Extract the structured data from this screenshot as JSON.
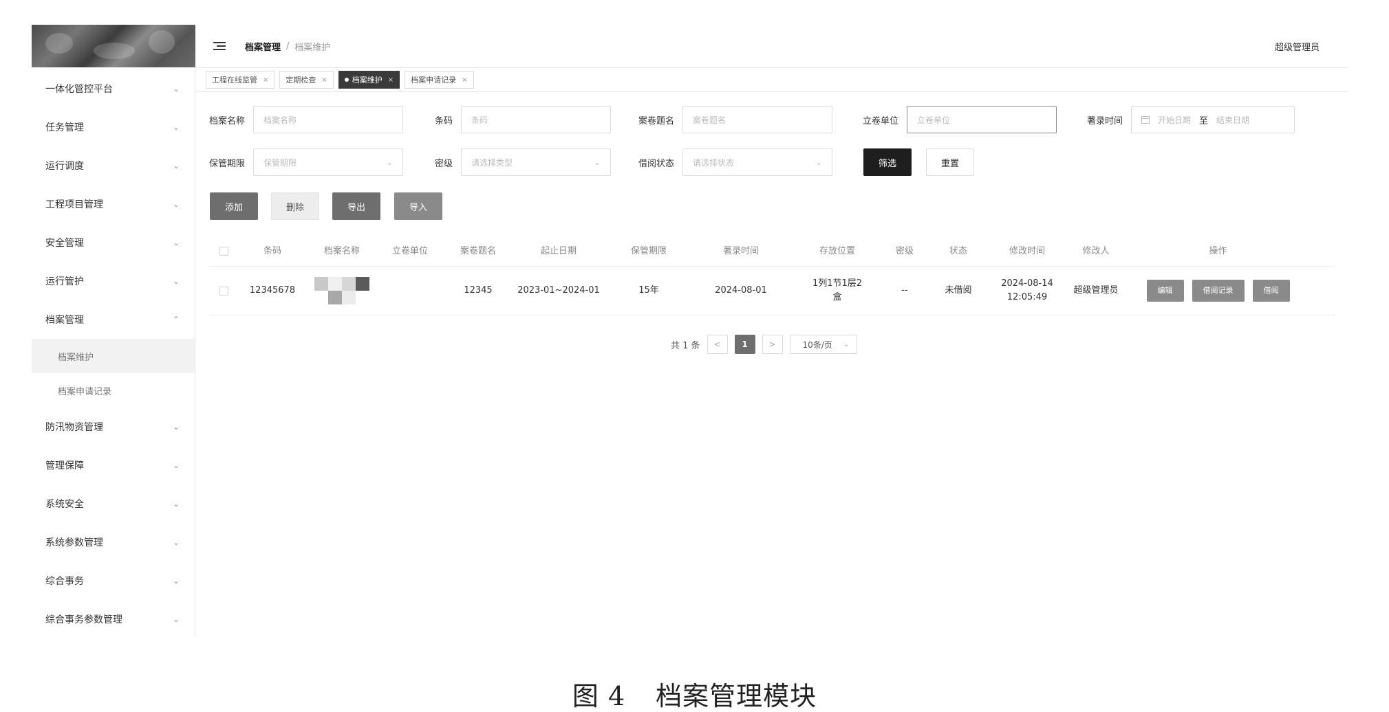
{
  "sidebar": {
    "items": [
      {
        "label": "一体化管控平台",
        "chevron": "v"
      },
      {
        "label": "任务管理",
        "chevron": "v"
      },
      {
        "label": "运行调度",
        "chevron": "v"
      },
      {
        "label": "工程项目管理",
        "chevron": "v"
      },
      {
        "label": "安全管理",
        "chevron": "v"
      },
      {
        "label": "运行管护",
        "chevron": "v"
      },
      {
        "label": "档案管理",
        "chevron": "^"
      },
      {
        "label": "防汛物资管理",
        "chevron": "v"
      },
      {
        "label": "管理保障",
        "chevron": "v"
      },
      {
        "label": "系统安全",
        "chevron": "v"
      },
      {
        "label": "系统参数管理",
        "chevron": "v"
      },
      {
        "label": "综合事务",
        "chevron": "v"
      },
      {
        "label": "综合事务参数管理",
        "chevron": "v"
      }
    ],
    "subitems": [
      {
        "label": "档案维护"
      },
      {
        "label": "档案申请记录"
      }
    ]
  },
  "header": {
    "breadcrumb": [
      "档案管理",
      "/",
      "档案维护"
    ],
    "user": "超级管理员"
  },
  "tabs": [
    {
      "label": "工程在线监管",
      "close": "×"
    },
    {
      "label": "定期检查",
      "close": "×"
    },
    {
      "label": "档案维护",
      "close": "×"
    },
    {
      "label": "档案申请记录",
      "close": "×"
    }
  ],
  "filters": {
    "archive_name": {
      "label": "档案名称",
      "placeholder": "档案名称"
    },
    "barcode": {
      "label": "条码",
      "placeholder": "条码"
    },
    "volume_title": {
      "label": "案卷题名",
      "placeholder": "案卷题名"
    },
    "filing_unit": {
      "label": "立卷单位",
      "placeholder": "立卷单位"
    },
    "entry_time": {
      "label": "著录时间",
      "start_placeholder": "开始日期",
      "to": "至",
      "end_placeholder": "结束日期"
    },
    "retention": {
      "label": "保管期限",
      "placeholder": "保管期限"
    },
    "secret_level": {
      "label": "密级",
      "placeholder": "请选择类型"
    },
    "borrow_status": {
      "label": "借阅状态",
      "placeholder": "请选择状态"
    },
    "filter_button": "筛选",
    "reset_button": "重置"
  },
  "actions": {
    "add": "添加",
    "delete": "删除",
    "export": "导出",
    "import": "导入"
  },
  "table": {
    "headers": [
      "条码",
      "档案名称",
      "立卷单位",
      "案卷题名",
      "起止日期",
      "保管期限",
      "著录时间",
      "存放位置",
      "密级",
      "状态",
      "修改时间",
      "修改人",
      "操作"
    ],
    "rows": [
      {
        "barcode": "12345678",
        "name": "",
        "unit": "",
        "title": "12345",
        "dates": "2023-01~2024-01",
        "retention": "15年",
        "entry_time": "2024-08-01",
        "location_line1": "1列1节1层2",
        "location_line2": "盒",
        "secret": "--",
        "status": "未借阅",
        "modified_date": "2024-08-14",
        "modified_time": "12:05:49",
        "modifier": "超级管理员",
        "ops": [
          "编辑",
          "借阅记录",
          "借阅"
        ]
      }
    ]
  },
  "pagination": {
    "total": "共 1 条",
    "prev": "<",
    "current": "1",
    "next": ">",
    "page_size": "10条/页"
  },
  "caption": {
    "number": "图 4",
    "text": "档案管理模块"
  }
}
